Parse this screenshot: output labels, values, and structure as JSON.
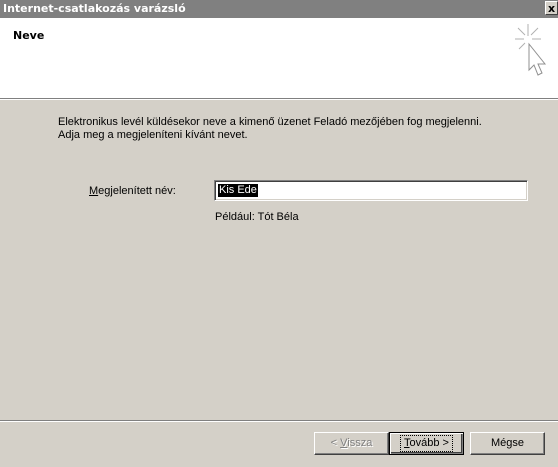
{
  "window": {
    "title": "Internet-csatlakozás varázsló",
    "close_label": "x"
  },
  "header": {
    "heading": "Neve",
    "icon": "wizard-sparkle-cursor-icon"
  },
  "body": {
    "description_line1": "Elektronikus levél küldésekor neve a kimenő üzenet Feladó mezőjében fog megjelenni.",
    "description_line2": "Adja meg a megjeleníteni kívánt nevet.",
    "name_label_accel": "M",
    "name_label_rest": "egjelenített név:",
    "name_value": "Kis Ede",
    "example_text": "Például: Tót Béla"
  },
  "buttons": {
    "back_prefix": "< ",
    "back_accel": "V",
    "back_rest": "issza",
    "next_accel": "T",
    "next_rest": "ovább >",
    "cancel_label": "Mégse"
  }
}
